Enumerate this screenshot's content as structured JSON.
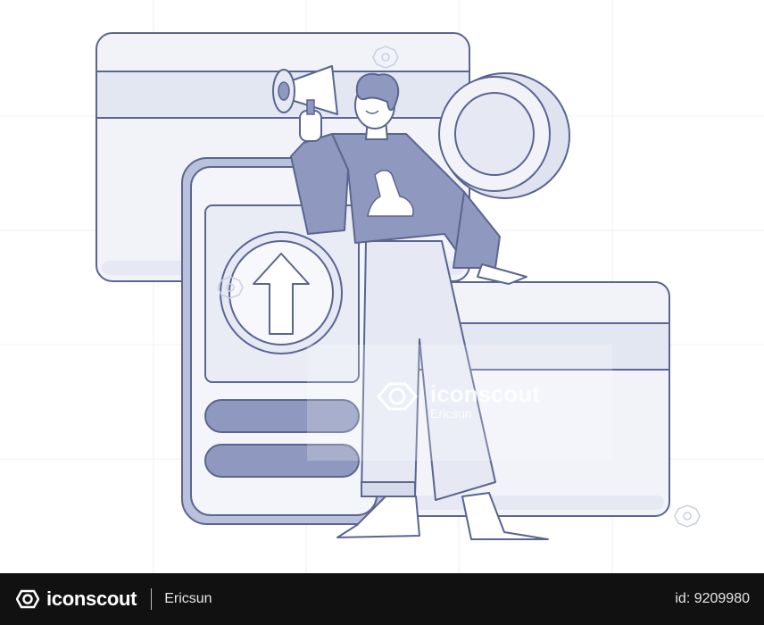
{
  "illustration": {
    "subject": "person-with-megaphone-phone-upload-cards-coin",
    "colors": {
      "outline": "#5a6590",
      "fill_dark": "#8f99bf",
      "fill_mid": "#b9c1dc",
      "fill_light": "#e6e9f4",
      "background": "#ffffff"
    }
  },
  "watermark": {
    "brand": "iconscout",
    "author": "Ericsun"
  },
  "footer": {
    "brand": "iconscout",
    "author": "Ericsun",
    "asset_id": "id: 9209980"
  }
}
